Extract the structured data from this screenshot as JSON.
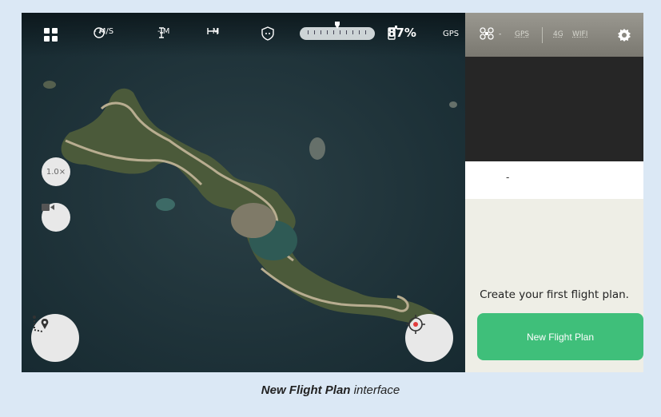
{
  "topbar": {
    "speed": "- M/S",
    "altitude": "- M",
    "distance": "- M",
    "battery": "87%",
    "gps": "GPS"
  },
  "panel_status": {
    "drone": "-",
    "gps": "GPS",
    "net_4g": "4G",
    "wifi": "WIFI"
  },
  "info_value": "-",
  "zoom_label": "1.0×",
  "create_text": "Create your first flight plan.",
  "new_button_label": "New Flight Plan",
  "caption": {
    "bold": "New Flight Plan",
    "rest": " interface"
  },
  "icons": [
    "grid-icon",
    "speed-icon",
    "altitude-icon",
    "distance-icon",
    "shield-icon",
    "phone-battery-icon",
    "drone-icon",
    "settings-gear-icon",
    "video-camera-icon",
    "route-pin-icon",
    "locate-crosshair-icon"
  ],
  "colors": {
    "accent_green": "#3fbf7a",
    "background": "#dbe8f5"
  }
}
